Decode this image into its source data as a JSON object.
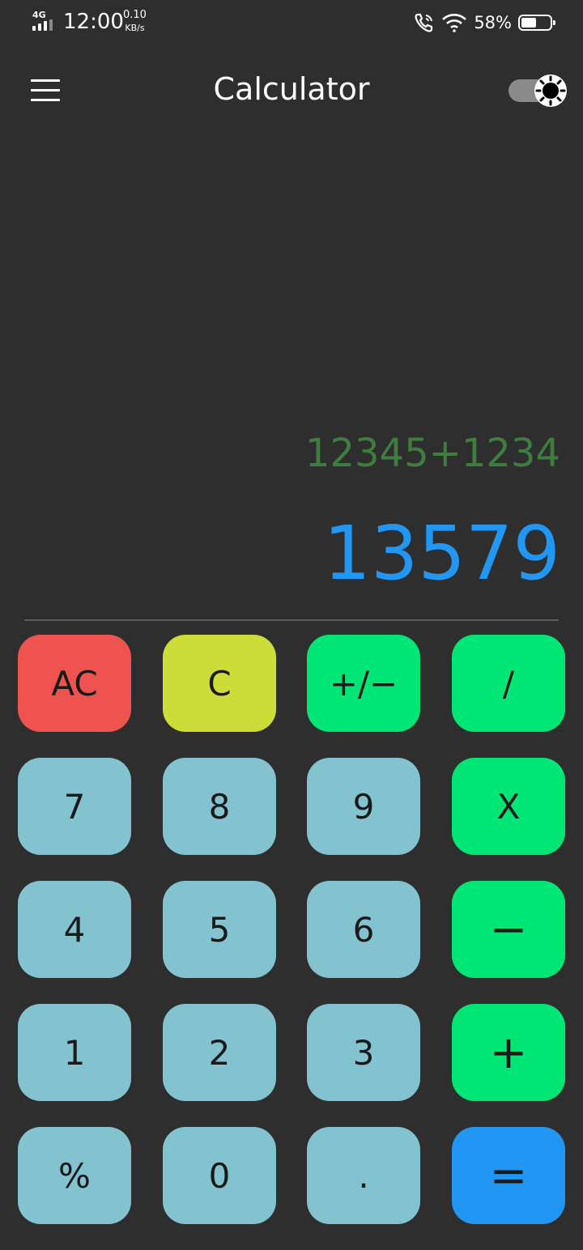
{
  "status_bar": {
    "network": "4G",
    "time": "12:00",
    "speed_value": "0.10",
    "speed_unit": "KB/s",
    "battery_percent": "58%",
    "battery_level": 0.58
  },
  "app_bar": {
    "title": "Calculator",
    "menu_icon": "hamburger-menu-icon",
    "theme_icon": "sun-icon"
  },
  "display": {
    "expression": "12345+1234",
    "result": "13579"
  },
  "keypad": {
    "rows": [
      [
        "AC",
        "C",
        "+/−",
        "/"
      ],
      [
        "7",
        "8",
        "9",
        "X"
      ],
      [
        "4",
        "5",
        "6",
        "−"
      ],
      [
        "1",
        "2",
        "3",
        "+"
      ],
      [
        "%",
        "0",
        ".",
        "="
      ]
    ]
  },
  "colors": {
    "background": "#2e2e2e",
    "clear_all": "#ef5350",
    "clear": "#cddc39",
    "operator": "#00e676",
    "digit": "#82c3cf",
    "equals": "#2196f3",
    "expression_text": "#3f7d3f",
    "result_text": "#2196f3"
  }
}
